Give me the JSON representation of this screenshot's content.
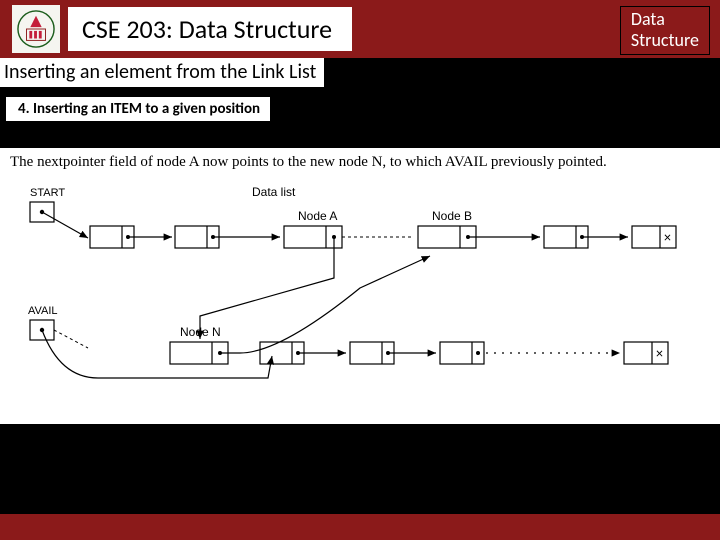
{
  "header": {
    "course_title": "CSE 203: Data Structure",
    "badge_line1": "Data",
    "badge_line2": "Structure"
  },
  "subtitle": "Inserting an element from the Link List",
  "section_heading": "4. Inserting an ITEM to a given position",
  "diagram": {
    "caption": "The nextpointer field of node A now points to the new node N, to which AVAIL previously pointed.",
    "labels": {
      "start": "START",
      "avail": "AVAIL",
      "data_list": "Data list",
      "node_a": "Node A",
      "node_b": "Node B",
      "node_n": "Node N",
      "terminator": "×"
    }
  }
}
